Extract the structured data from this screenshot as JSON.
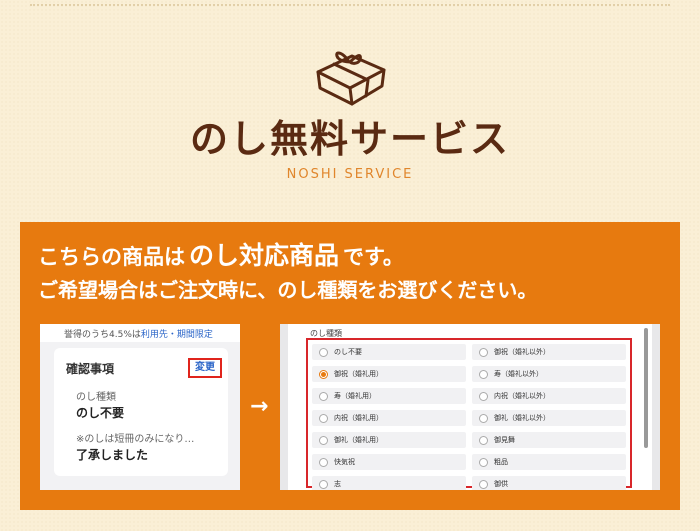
{
  "header": {
    "title": "のし無料サービス",
    "subtitle": "NOSHI SERVICE",
    "icon": "gift-box-icon"
  },
  "panel": {
    "line1_pre": "こちらの商品は",
    "line1_emph": "のし対応商品",
    "line1_post": "です。",
    "line2": "ご希望場合はご注文時に、のし種類をお選びください。"
  },
  "left_screenshot": {
    "strip_pre": "誉得のうち4.5%は",
    "strip_link": "利用先・期間限定",
    "card_title": "確認事項",
    "change_button": "変更",
    "field1_label": "のし種類",
    "field1_value": "のし不要",
    "field2_label": "※のしは短冊のみになり…",
    "field2_value": "了承しました"
  },
  "arrow": "→",
  "right_screenshot": {
    "section_label": "のし種類",
    "options_left": [
      "のし不要",
      "御祝（婚礼用）",
      "寿（婚礼用）",
      "内祝（婚礼用）",
      "御礼（婚礼用）",
      "快気祝",
      "志"
    ],
    "options_right": [
      "御祝（婚礼以外）",
      "寿（婚礼以外）",
      "内祝（婚礼以外）",
      "御礼（婚礼以外）",
      "御見舞",
      "粗品",
      "御供"
    ],
    "selected": "御祝（婚礼用）"
  }
}
